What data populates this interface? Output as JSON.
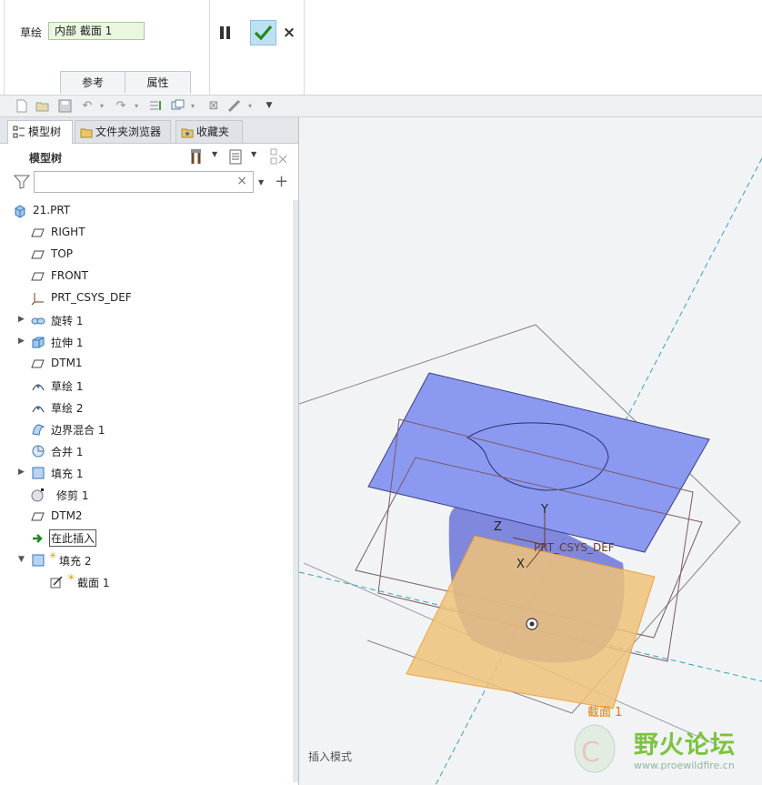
{
  "dashboard": {
    "sketch_label": "草绘",
    "section_value": "内部 截面 1",
    "tabs": [
      "参考",
      "属性"
    ]
  },
  "panel": {
    "tabs": [
      "模型树",
      "文件夹浏览器",
      "收藏夹"
    ],
    "title": "模型树",
    "filter": {
      "value": "",
      "clear_icon": "×"
    }
  },
  "tree": {
    "items": [
      {
        "label": "21.PRT",
        "icon": "part-icon"
      },
      {
        "label": "RIGHT",
        "icon": "datum-plane-icon"
      },
      {
        "label": "TOP",
        "icon": "datum-plane-icon"
      },
      {
        "label": "FRONT",
        "icon": "datum-plane-icon"
      },
      {
        "label": "PRT_CSYS_DEF",
        "icon": "csys-icon"
      },
      {
        "label": "旋转 1",
        "icon": "revolve-icon"
      },
      {
        "label": "拉伸 1",
        "icon": "extrude-icon"
      },
      {
        "label": "DTM1",
        "icon": "datum-plane-icon"
      },
      {
        "label": "草绘 1",
        "icon": "sketch-icon"
      },
      {
        "label": "草绘 2",
        "icon": "sketch-icon"
      },
      {
        "label": "边界混合 1",
        "icon": "boundary-blend-icon"
      },
      {
        "label": "合并 1",
        "icon": "merge-icon"
      },
      {
        "label": "填充 1",
        "icon": "fill-icon"
      },
      {
        "label": "修剪 1",
        "icon": "trim-icon"
      },
      {
        "label": "DTM2",
        "icon": "datum-plane-icon"
      },
      {
        "label": "在此插入",
        "icon": "insert-arrow-icon"
      },
      {
        "label": "填充 2",
        "icon": "fill-icon"
      },
      {
        "label": "截面 1",
        "icon": "section-sketch-icon"
      }
    ]
  },
  "graphics": {
    "mode_text": "插入模式",
    "axis_labels": {
      "y": "Y",
      "z": "Z",
      "x": "X"
    },
    "csys_label": "PRT_CSYS_DEF",
    "section_label": "截面 1",
    "watermark_cn": "野火论坛",
    "watermark_url": "www.proewildfire.cn",
    "colors": {
      "blue_plane": "#8c99f0",
      "orange_plane": "#f0c27a",
      "section_text": "#e07a00",
      "watermark": "#7cc33f"
    }
  }
}
